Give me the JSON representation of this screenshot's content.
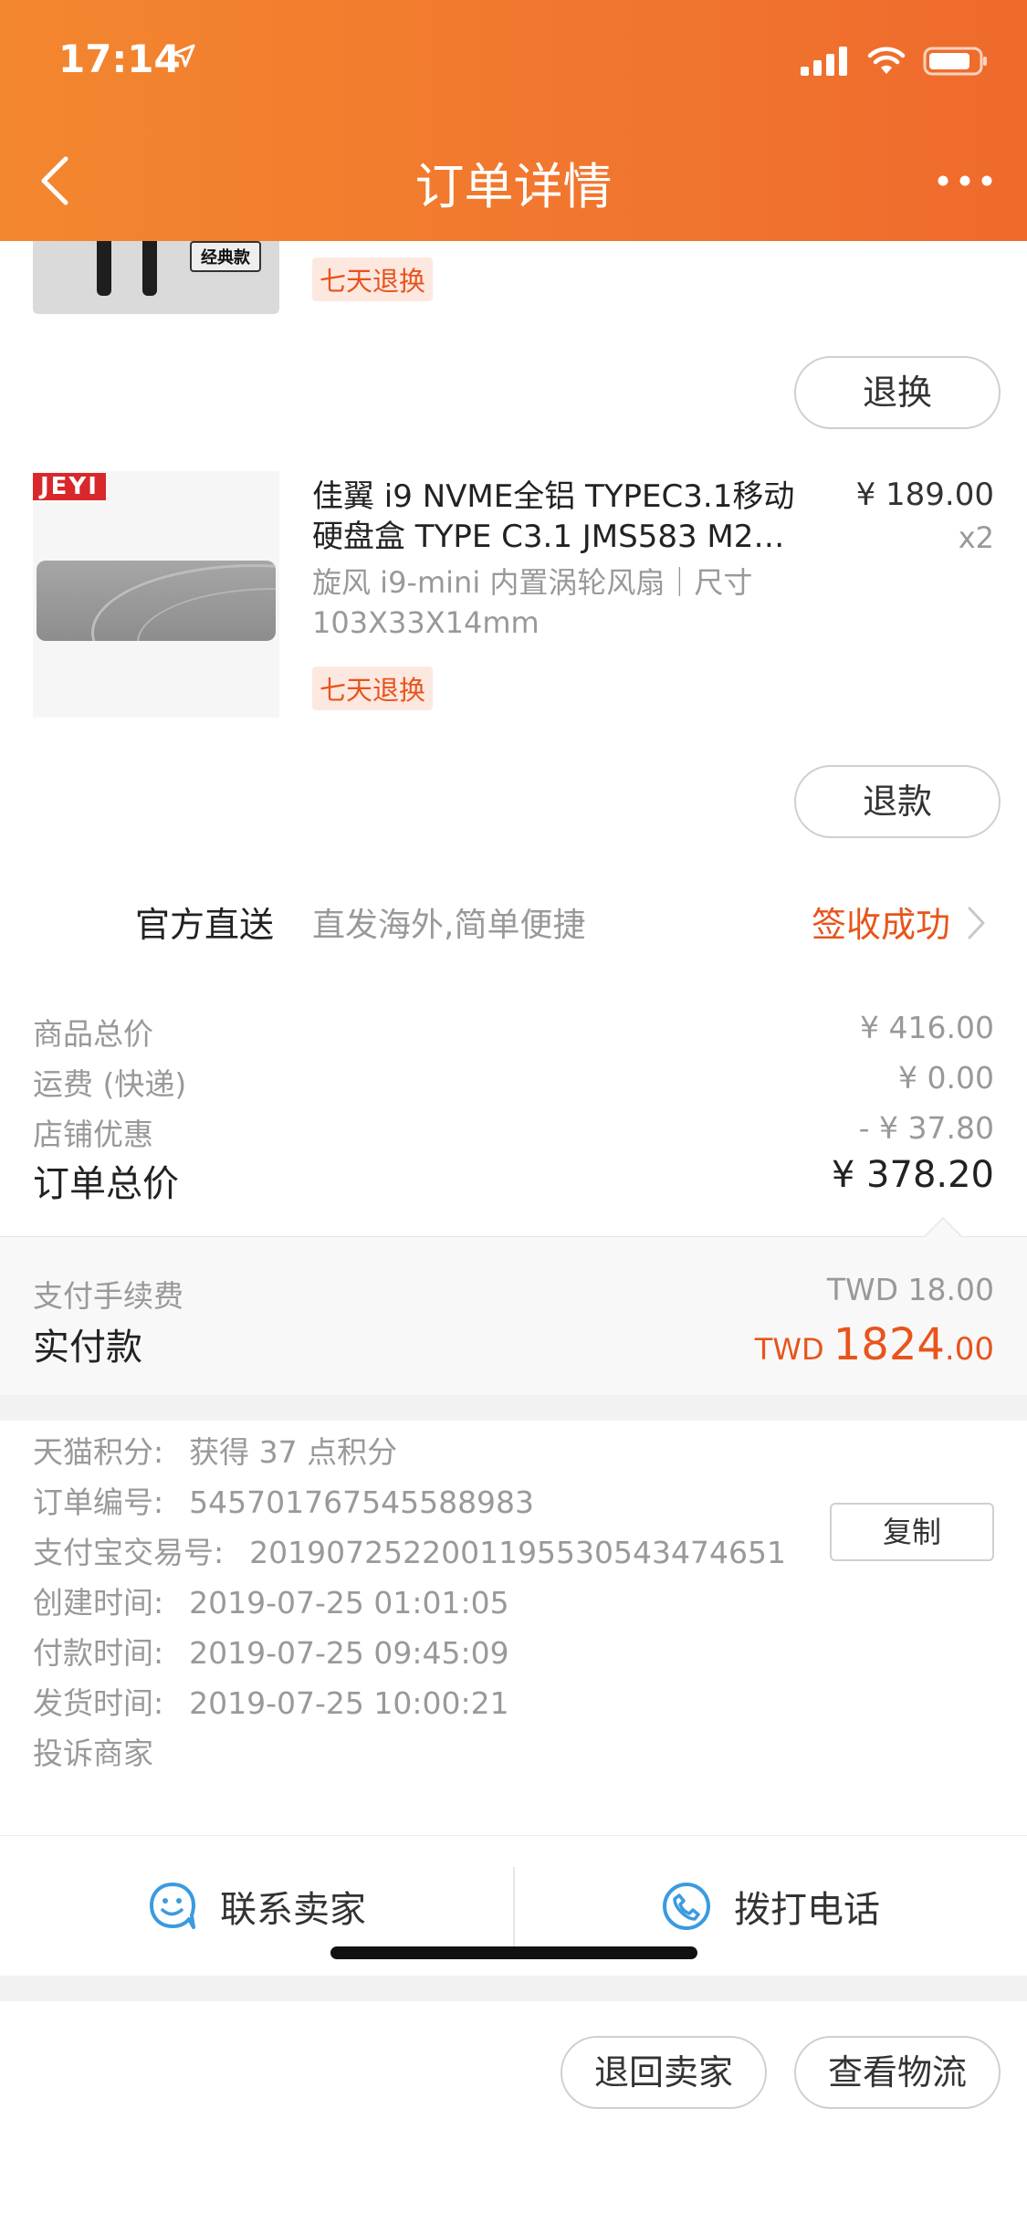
{
  "status_bar": {
    "time": "17:14"
  },
  "nav": {
    "title": "订单详情"
  },
  "item_top": {
    "thumb_tag": "经典款",
    "return_tag": "七天退换",
    "action_label": "退换"
  },
  "item2": {
    "brand_logo": "JEYI",
    "title_line1": "佳翼 i9 NVME全铝 TYPEC3.1移动",
    "title_line2": "硬盘盒 TYPE C3.1 JMS583 M2…",
    "price": "¥ 189.00",
    "quantity": "x2",
    "spec_line1": "旋风 i9-mini 内置涡轮风扇｜尺寸",
    "spec_line2": "103X33X14mm",
    "return_tag": "七天退换",
    "action_label": "退款"
  },
  "shipping": {
    "label": "官方直送",
    "description": "直发海外,简单便捷",
    "status": "签收成功"
  },
  "summary": {
    "goods_label": "商品总价",
    "goods_value": "¥ 416.00",
    "freight_label": "运费 (快递)",
    "freight_value": "¥ 0.00",
    "discount_label": "店铺优惠",
    "discount_value": "- ¥ 37.80",
    "total_label": "订单总价",
    "total_value": "¥ 378.20"
  },
  "payment": {
    "fee_label": "支付手续费",
    "fee_value": "TWD 18.00",
    "paid_label": "实付款",
    "paid_currency": "TWD ",
    "paid_integer": "1824",
    "paid_decimal": ".00"
  },
  "order_info": {
    "points_label": "天猫积分:",
    "points_value": "获得 37 点积分",
    "order_no_label": "订单编号:",
    "order_no_value": "545701767545588983",
    "alipay_label": "支付宝交易号:",
    "alipay_value": "2019072522001195530543474651",
    "created_label": "创建时间:",
    "created_value": "2019-07-25 01:01:05",
    "paid_label": "付款时间:",
    "paid_value": "2019-07-25 09:45:09",
    "shipped_label": "发货时间:",
    "shipped_value": "2019-07-25 10:00:21",
    "complain_label": "投诉商家",
    "copy_label": "复制"
  },
  "contact": {
    "seller_label": "联系卖家",
    "phone_label": "拨打电话"
  },
  "bottom_actions": {
    "return_label": "退回卖家",
    "logistics_label": "查看物流"
  },
  "colors": {
    "header_start": "#f3872f",
    "header_end": "#ef6a2d",
    "accent": "#e8541c",
    "icon_blue": "#3a9be0"
  }
}
